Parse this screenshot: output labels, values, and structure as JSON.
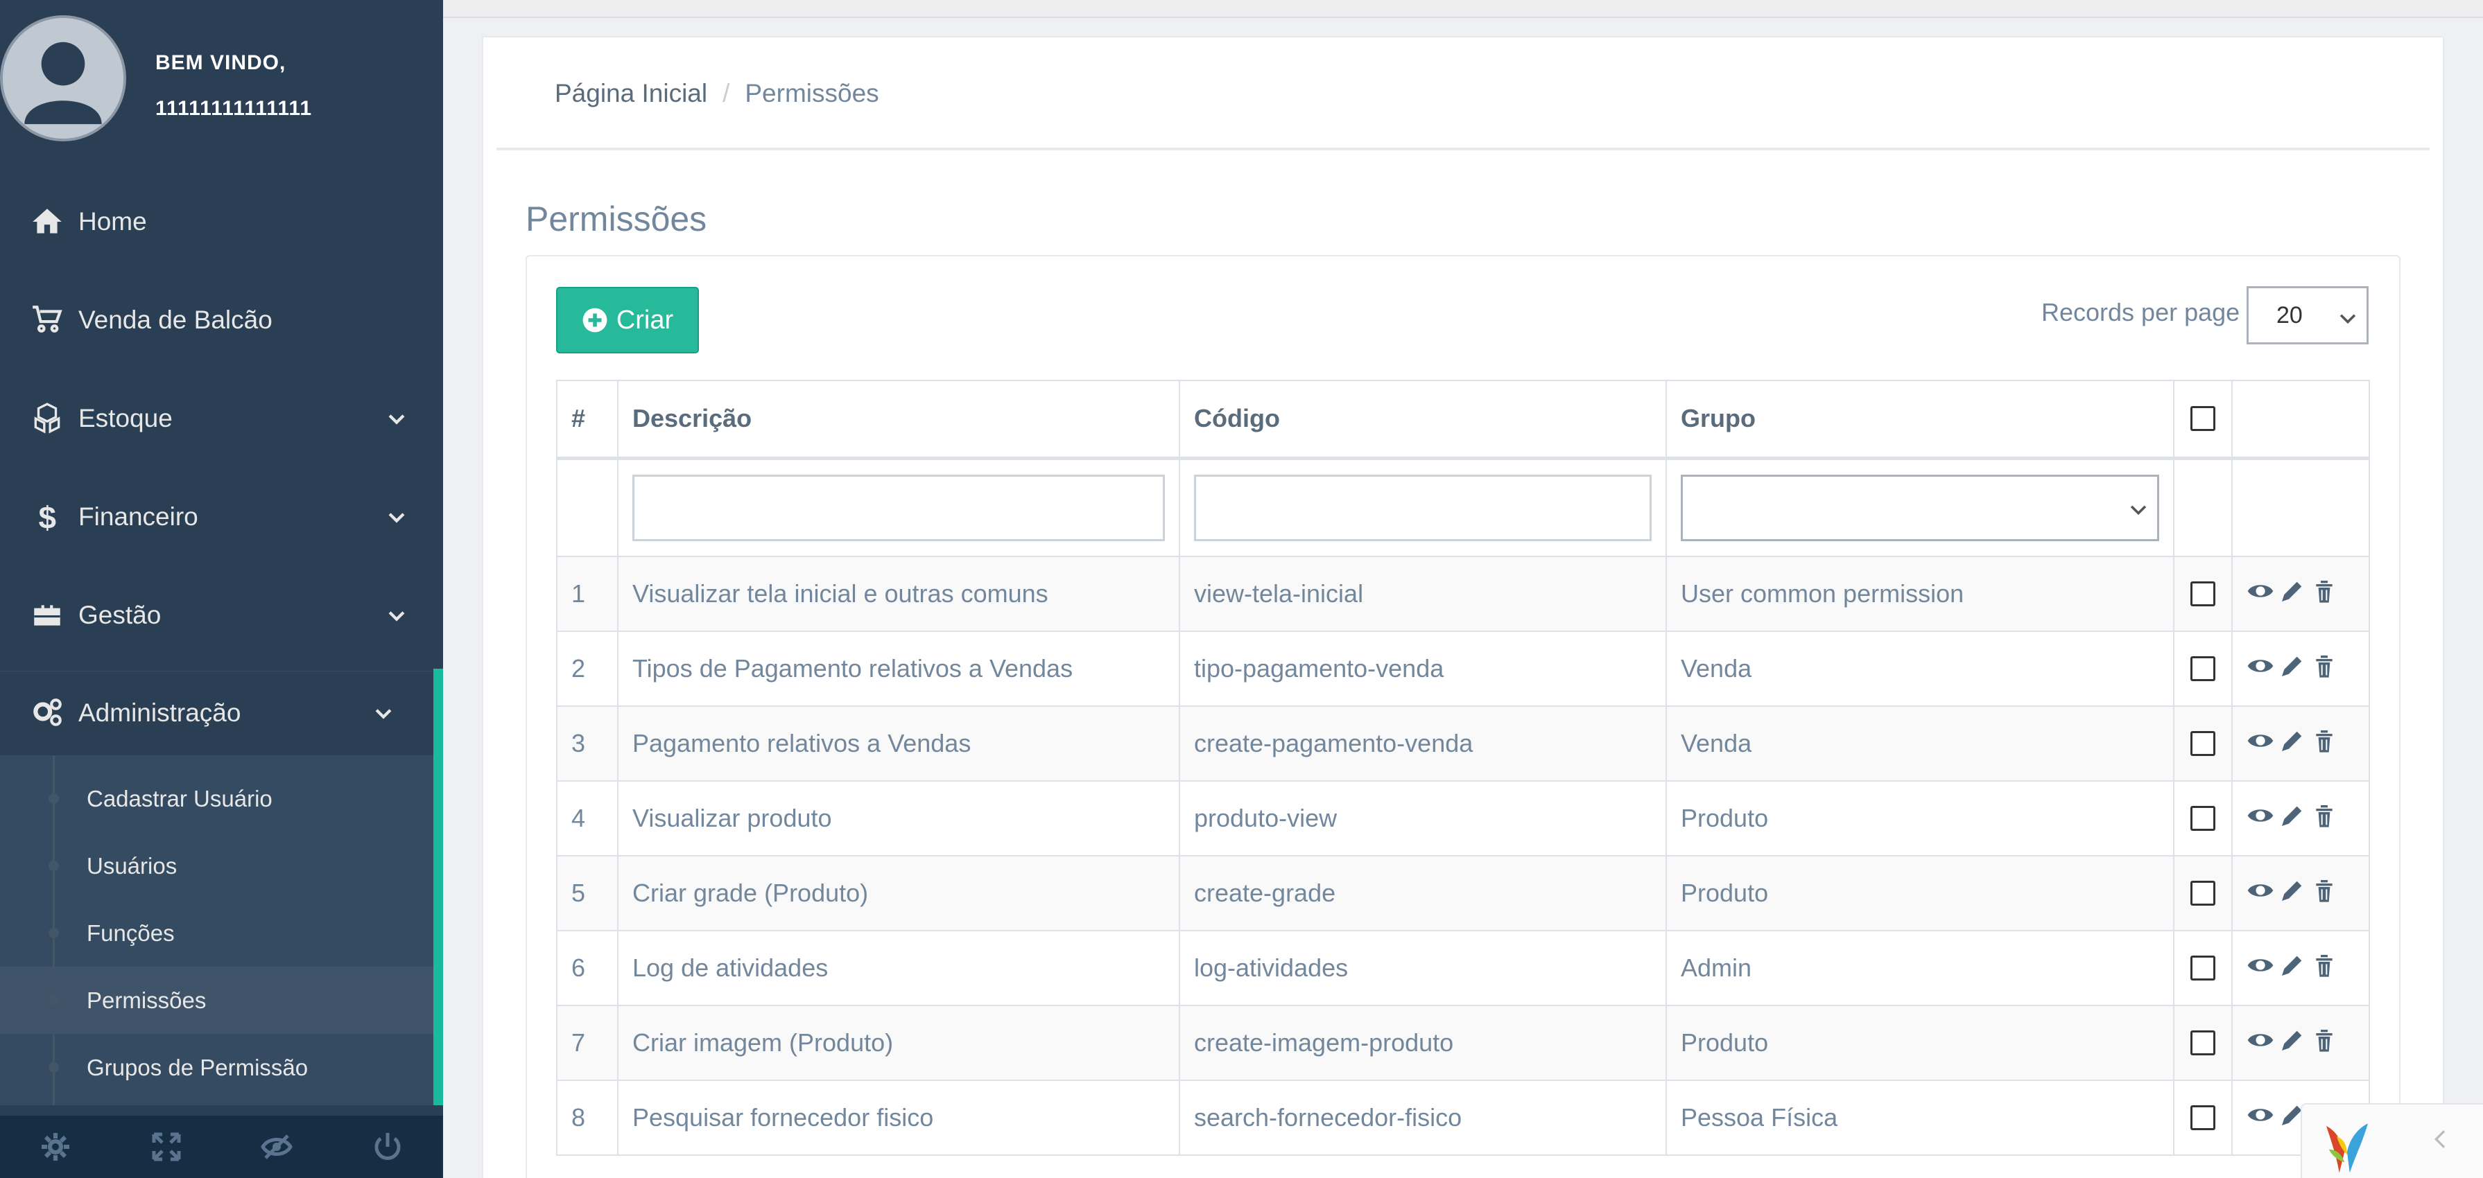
{
  "profile": {
    "welcome": "BEM VINDO,",
    "username": "11111111111111"
  },
  "nav": {
    "items": [
      {
        "label": "Home",
        "icon": "home-icon"
      },
      {
        "label": "Venda de Balcão",
        "icon": "cart-icon"
      },
      {
        "label": "Estoque",
        "icon": "cubes-icon"
      },
      {
        "label": "Financeiro",
        "icon": "dollar-icon"
      },
      {
        "label": "Gestão",
        "icon": "briefcase-icon"
      },
      {
        "label": "Administração",
        "icon": "gears-icon"
      }
    ],
    "submenu": [
      {
        "label": "Cadastrar Usuário"
      },
      {
        "label": "Usuários"
      },
      {
        "label": "Funções"
      },
      {
        "label": "Permissões"
      },
      {
        "label": "Grupos de Permissão"
      }
    ],
    "footer": [
      "gear-icon",
      "fullscreen-icon",
      "eye-slash-icon",
      "power-icon"
    ]
  },
  "breadcrumb": {
    "home": "Página Inicial",
    "separator": "/",
    "current": "Permissões"
  },
  "page": {
    "title": "Permissões"
  },
  "toolbar": {
    "create_label": "Criar",
    "records_label": "Records per page",
    "records_value": "20"
  },
  "table": {
    "headers": {
      "idx": "#",
      "desc": "Descrição",
      "code": "Código",
      "group": "Grupo"
    },
    "rows": [
      {
        "idx": "1",
        "desc": "Visualizar tela inicial e outras comuns",
        "code": "view-tela-inicial",
        "group": "User common permission"
      },
      {
        "idx": "2",
        "desc": "Tipos de Pagamento relativos a Vendas",
        "code": "tipo-pagamento-venda",
        "group": "Venda"
      },
      {
        "idx": "3",
        "desc": "Pagamento relativos a Vendas",
        "code": "create-pagamento-venda",
        "group": "Venda"
      },
      {
        "idx": "4",
        "desc": "Visualizar produto",
        "code": "produto-view",
        "group": "Produto"
      },
      {
        "idx": "5",
        "desc": "Criar grade (Produto)",
        "code": "create-grade",
        "group": "Produto"
      },
      {
        "idx": "6",
        "desc": "Log de atividades",
        "code": "log-atividades",
        "group": "Admin"
      },
      {
        "idx": "7",
        "desc": "Criar imagem (Produto)",
        "code": "create-imagem-produto",
        "group": "Produto"
      },
      {
        "idx": "8",
        "desc": "Pesquisar fornecedor fisico",
        "code": "search-fornecedor-fisico",
        "group": "Pessoa Física"
      }
    ]
  },
  "colors": {
    "sidebar": "#2a3f54",
    "accent": "#1abb9c",
    "create_button": "#26b99a"
  }
}
